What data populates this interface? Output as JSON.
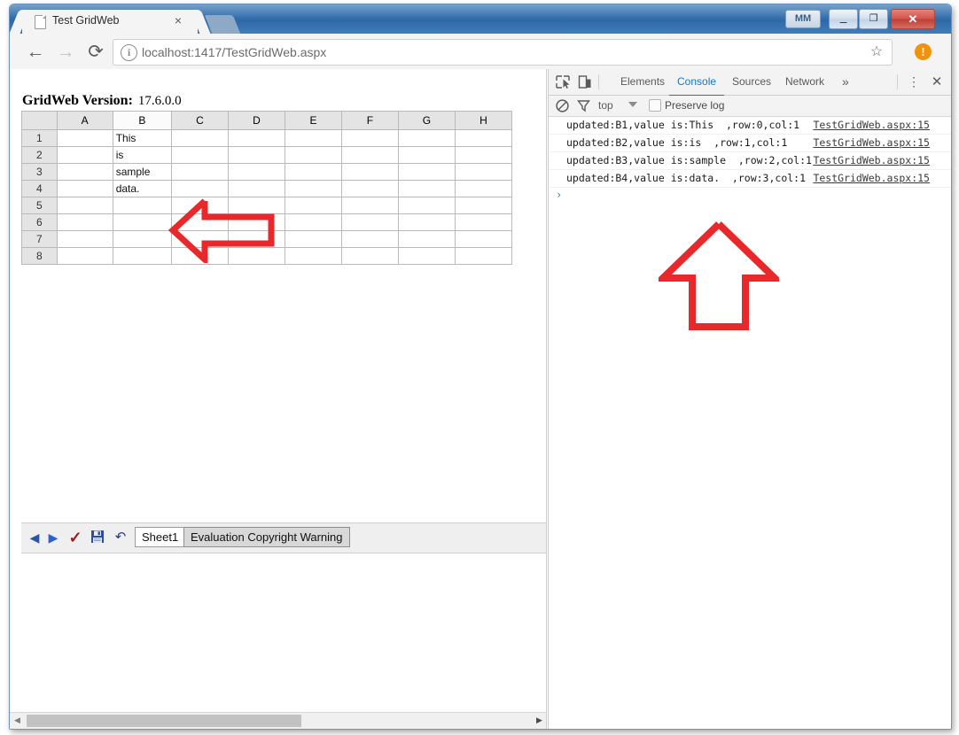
{
  "browser": {
    "tab": {
      "title": "Test GridWeb",
      "close_label": "×",
      "doc_icon": "page-icon"
    },
    "new_tab_label": "",
    "window_controls": {
      "profile_label": "MM",
      "minimize": "–",
      "maximize": "❐",
      "close": "✕"
    },
    "toolbar": {
      "back": "←",
      "forward": "→",
      "reload": "⟳",
      "info_icon": "i",
      "url": "localhost:1417/TestGridWeb.aspx",
      "bookmark_icon": "☆",
      "update_icon": "!"
    }
  },
  "page": {
    "version_label": "GridWeb Version:",
    "version_value": "17.6.0.0",
    "grid": {
      "columns": [
        "A",
        "B",
        "C",
        "D",
        "E",
        "F",
        "G",
        "H"
      ],
      "selected_column": "B",
      "rows": [
        "1",
        "2",
        "3",
        "4",
        "5",
        "6",
        "7",
        "8"
      ],
      "cells": {
        "B1": "This",
        "B2": "is",
        "B3": "sample",
        "B4": "data."
      }
    },
    "grid_toolbar": {
      "prev": "◀",
      "next": "▶",
      "confirm": "✓",
      "save": "save-icon",
      "undo": "↶",
      "sheet_tab": "Sheet1",
      "eval_warning": "Evaluation Copyright Warning"
    },
    "scrollbar": {
      "left_arrow": "◀",
      "right_arrow": "▶"
    },
    "annotations": {
      "grid_arrow": "red-left-arrow",
      "console_arrow": "red-up-arrow",
      "arrow_color": "#E8282B"
    }
  },
  "devtools": {
    "tabs": [
      {
        "label": "Elements",
        "active": false
      },
      {
        "label": "Console",
        "active": true
      },
      {
        "label": "Sources",
        "active": false
      },
      {
        "label": "Network",
        "active": false
      }
    ],
    "more_tabs": "»",
    "kebab": "⋮",
    "close": "✕",
    "filter_bar": {
      "clear_console": "clear-console-icon",
      "filter": "filter-icon",
      "context": "top",
      "preserve_log": "Preserve log",
      "preserve_log_checked": false
    },
    "console_messages": [
      {
        "text": "updated:B1,value is:This  ,row:0,col:1",
        "source": "TestGridWeb.aspx:15"
      },
      {
        "text": "updated:B2,value is:is  ,row:1,col:1",
        "source": "TestGridWeb.aspx:15"
      },
      {
        "text": "updated:B3,value is:sample  ,row:2,col:1",
        "source": "TestGridWeb.aspx:15"
      },
      {
        "text": "updated:B4,value is:data.  ,row:3,col:1",
        "source": "TestGridWeb.aspx:15"
      }
    ],
    "prompt": "›"
  }
}
